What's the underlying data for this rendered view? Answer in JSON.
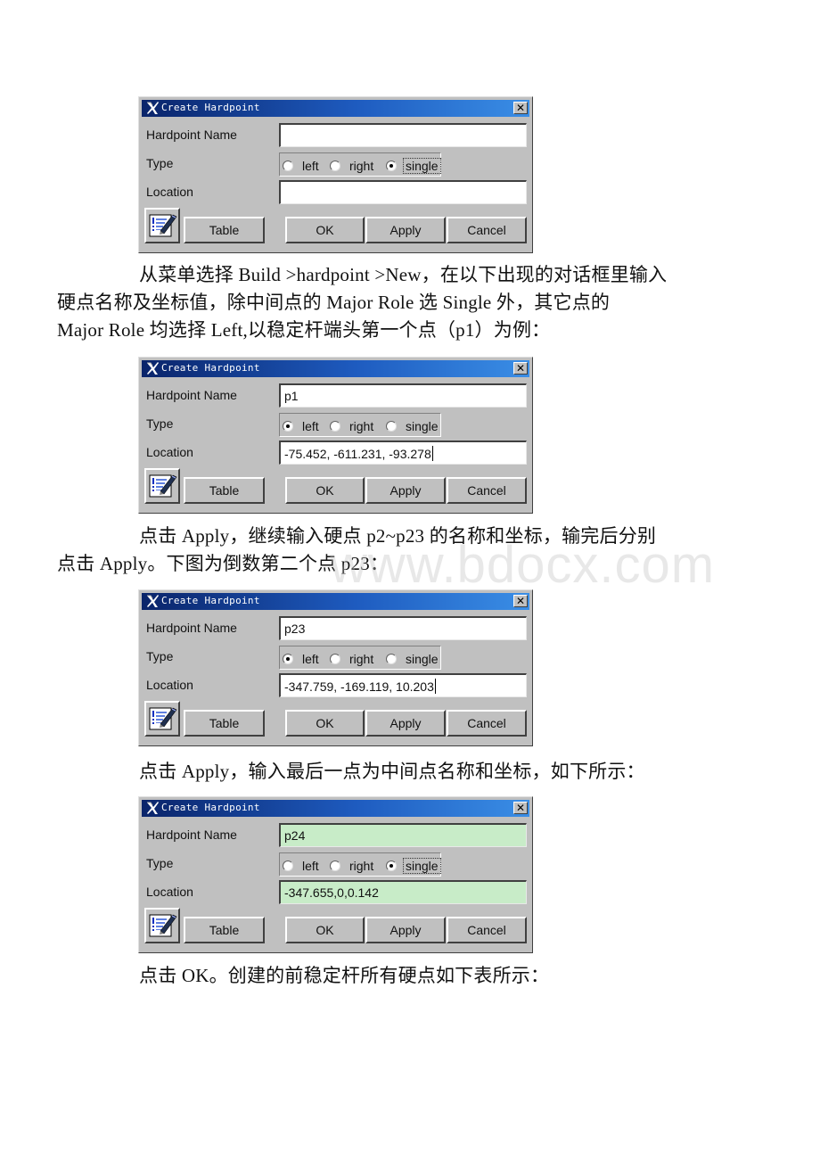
{
  "paragraphs": {
    "p1": [
      "从菜单选择 Build >hardpoint >New，在以下出现的对话框里输入",
      "硬点名称及坐标值，除中间点的 Major Role 选 Single 外，其它点的",
      "Major Role 均选择 Left,以稳定杆端头第一个点（p1）为例："
    ],
    "p2": [
      "点击 Apply，继续输入硬点 p2~p23 的名称和坐标，输完后分别",
      "点击 Apply。下图为倒数第二个点 p23："
    ],
    "p3": [
      "点击 Apply，输入最后一点为中间点名称和坐标，如下所示："
    ],
    "p4": [
      "点击 OK。创建的前稳定杆所有硬点如下表所示："
    ]
  },
  "watermark": "www.bdocx.com",
  "dialog_common": {
    "title": "Create Hardpoint",
    "close_glyph": "✕",
    "labels": {
      "name": "Hardpoint Name",
      "type": "Type",
      "location": "Location"
    },
    "radio_options": [
      "left",
      "right",
      "single"
    ],
    "buttons": {
      "table": "Table",
      "ok": "OK",
      "apply": "Apply",
      "cancel": "Cancel"
    },
    "icons": {
      "title": "adams-x-icon",
      "table_editor": "table-editor-icon"
    }
  },
  "dialogs": [
    {
      "hardpoint_name": "",
      "type_selected": "single",
      "location": "",
      "field_highlight": false,
      "show_caret": false
    },
    {
      "hardpoint_name": "p1",
      "type_selected": "left",
      "location": "-75.452, -611.231, -93.278",
      "field_highlight": false,
      "show_caret": true
    },
    {
      "hardpoint_name": "p23",
      "type_selected": "left",
      "location": "-347.759, -169.119, 10.203",
      "field_highlight": false,
      "show_caret": true
    },
    {
      "hardpoint_name": "p24",
      "type_selected": "single",
      "location": "-347.655,0,0.142",
      "field_highlight": true,
      "show_caret": false
    }
  ],
  "colors": {
    "dialog_bg": "#c0c0c0",
    "titlebar_start": "#0a246a",
    "titlebar_end": "#3a8ee6",
    "highlight_field": "#c8ecc8"
  }
}
